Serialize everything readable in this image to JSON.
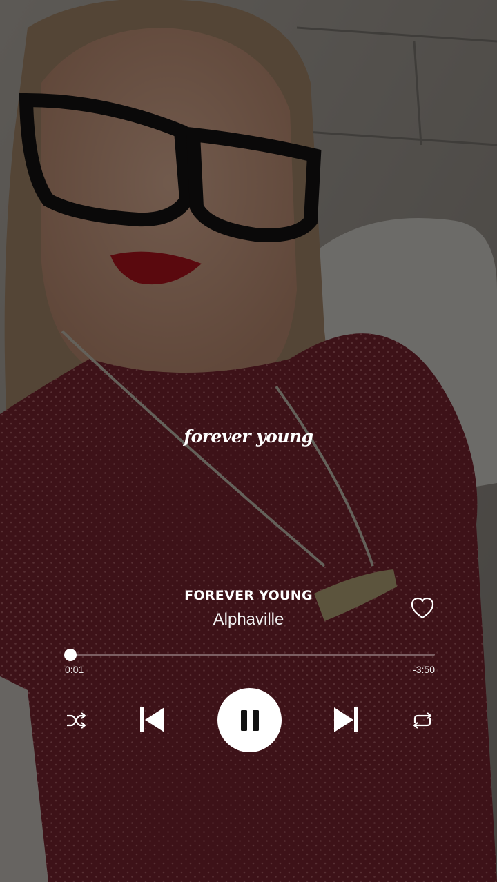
{
  "lyric": "forever young",
  "track": {
    "title": "FOREVER YOUNG",
    "artist": "Alphaville"
  },
  "progress": {
    "elapsed": "0:01",
    "remaining": "-3:50",
    "fraction": 0.004
  },
  "icons": {
    "like": "heart-icon",
    "shuffle": "shuffle-icon",
    "previous": "skip-previous-icon",
    "play_pause": "pause-icon",
    "next": "skip-next-icon",
    "repeat": "repeat-icon"
  },
  "colors": {
    "accent": "#ffffff",
    "shirt": "#7a2430",
    "overlay": "#000000"
  }
}
